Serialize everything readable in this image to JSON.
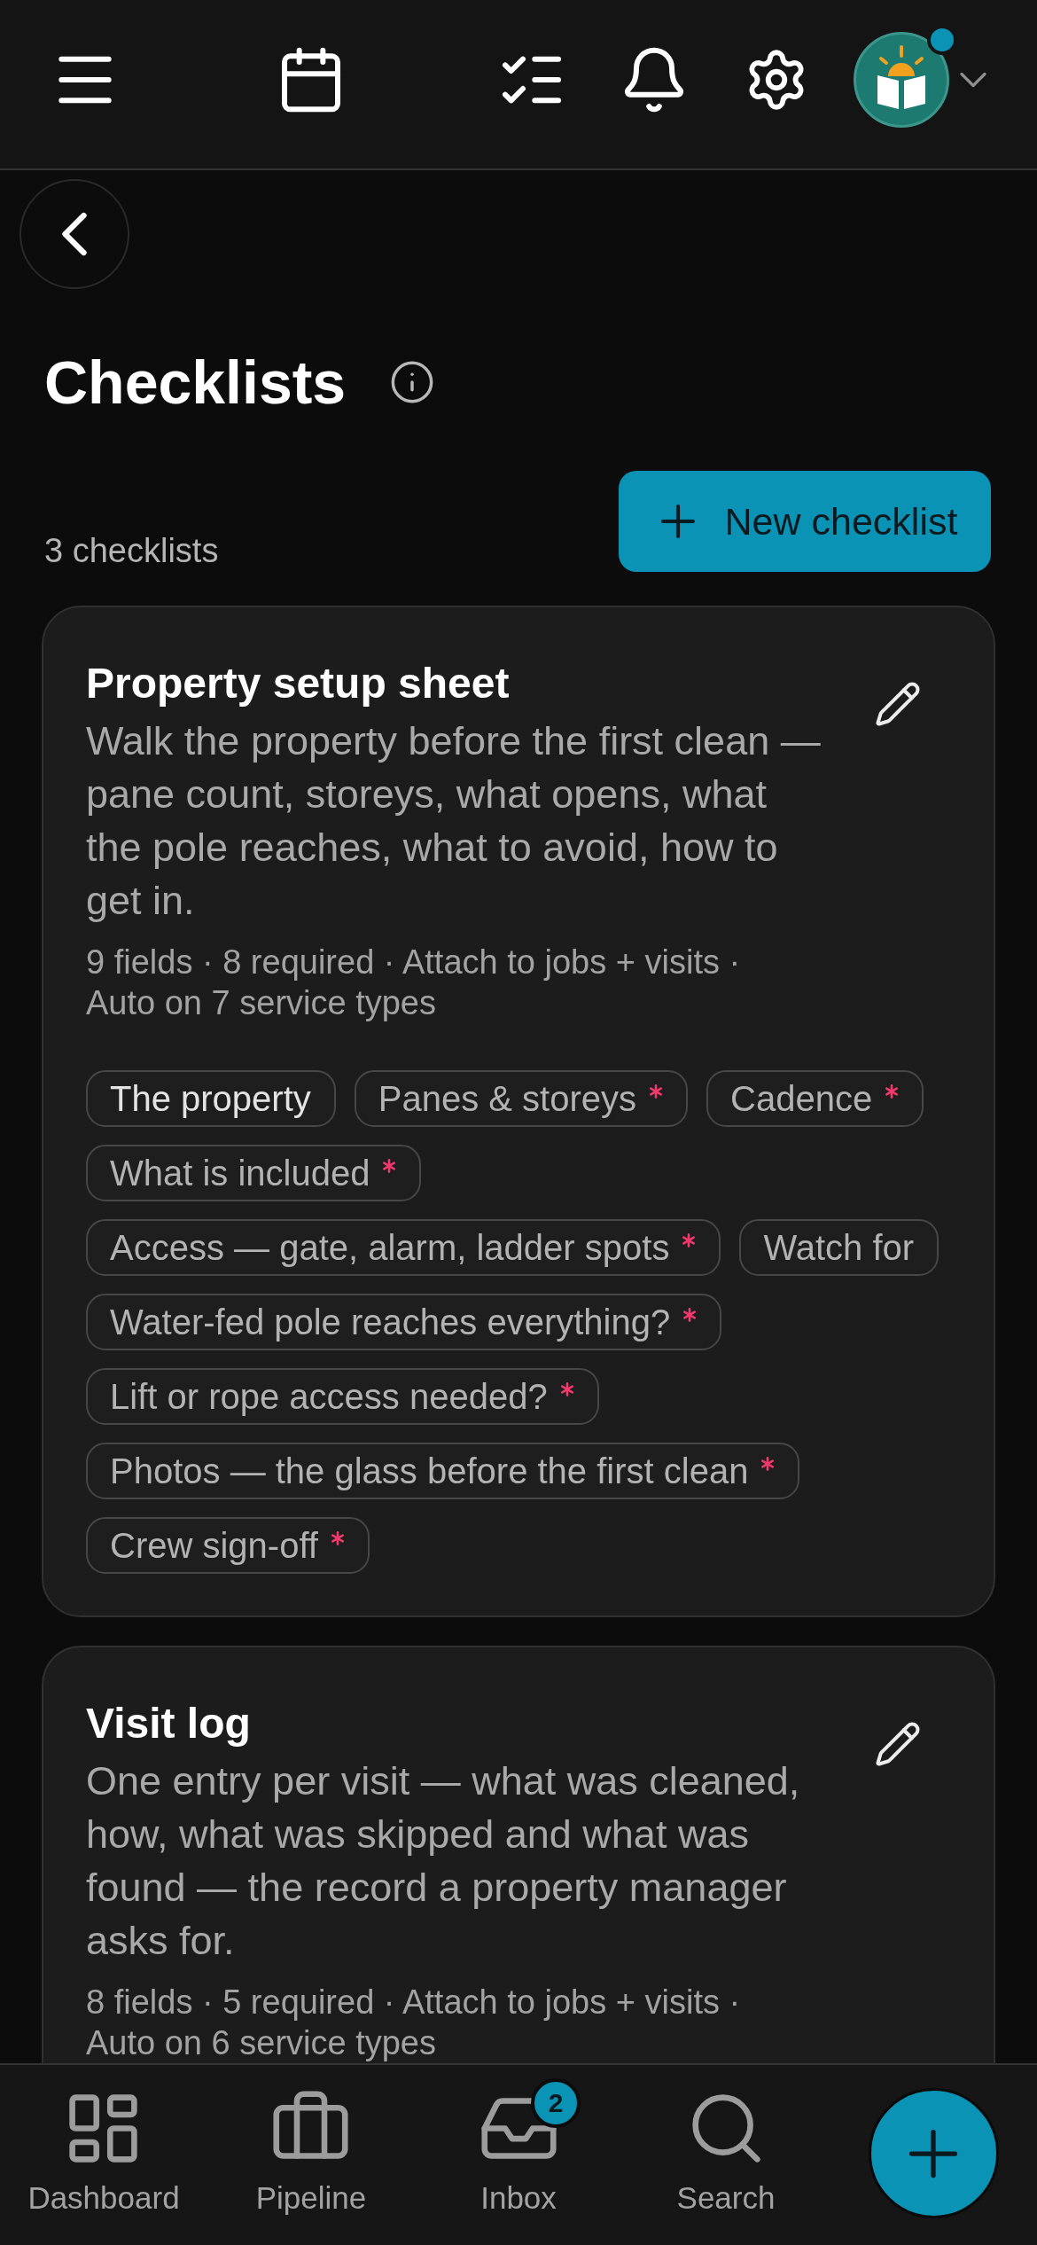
{
  "top_bar": {
    "avatar": {
      "notification": true
    }
  },
  "header": {
    "title": "Checklists",
    "count": "3 checklists",
    "new_button": {
      "label": "New checklist"
    }
  },
  "checklists": [
    {
      "title": "Property setup sheet",
      "description": "Walk the property before the first clean — pane count, storeys, what opens, what the pole reaches, what to avoid, how to get in.",
      "meta": "9 fields · 8 required · Attach to jobs + visits · Auto on 7 service types",
      "fields": [
        {
          "kind": "section",
          "label": "The property"
        },
        {
          "kind": "field",
          "label": "Panes & storeys",
          "required": true
        },
        {
          "kind": "field",
          "label": "Cadence",
          "required": true
        },
        {
          "kind": "field",
          "label": "What is included",
          "required": true
        },
        {
          "kind": "field",
          "label": "Access — gate, alarm, ladder spots",
          "required": true
        },
        {
          "kind": "field",
          "label": "Watch for",
          "required": false
        },
        {
          "kind": "field",
          "label": "Water-fed pole reaches everything?",
          "required": true
        },
        {
          "kind": "field",
          "label": "Lift or rope access needed?",
          "required": true
        },
        {
          "kind": "field",
          "label": "Photos — the glass before the first clean",
          "required": true
        },
        {
          "kind": "field",
          "label": "Crew sign-off",
          "required": true
        }
      ]
    },
    {
      "title": "Visit log",
      "description": "One entry per visit — what was cleaned, how, what was skipped and what was found — the record a property manager asks for.",
      "meta": "8 fields · 5 required · Attach to jobs + visits · Auto on 6 service types"
    }
  ],
  "bottom_nav": {
    "items": [
      {
        "label": "Dashboard"
      },
      {
        "label": "Pipeline"
      },
      {
        "label": "Inbox",
        "badge": "2"
      },
      {
        "label": "Search"
      }
    ]
  }
}
